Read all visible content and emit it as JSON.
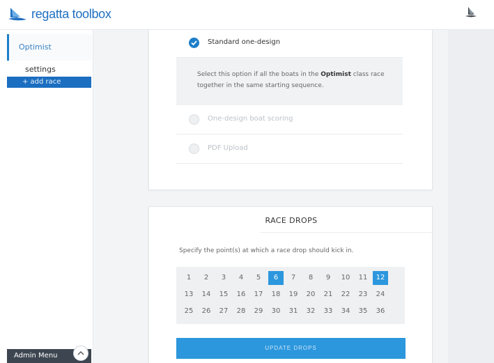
{
  "app": {
    "title": "regatta toolbox"
  },
  "sidebar": {
    "class_name": "Optimist",
    "settings_label": "settings",
    "add_race_label": "+ add race",
    "admin_menu_label": "Admin Menu"
  },
  "scoring": {
    "options": [
      {
        "label": "Standard one-design",
        "selected": true
      },
      {
        "label": "One-design boat scoring",
        "selected": false
      },
      {
        "label": "PDF Upload",
        "selected": false
      }
    ],
    "description_pre": "Select this option if all the boats in the ",
    "description_bold": "Optimist",
    "description_post": " class race together in the same starting sequence."
  },
  "race_drops": {
    "title": "RACE DROPS",
    "instruction": "Specify the point(s) at which a race drop should kick in.",
    "numbers": [
      1,
      2,
      3,
      4,
      5,
      6,
      7,
      8,
      9,
      10,
      11,
      12,
      13,
      14,
      15,
      16,
      17,
      18,
      19,
      20,
      21,
      22,
      23,
      24,
      25,
      26,
      27,
      28,
      29,
      30,
      31,
      32,
      33,
      34,
      35,
      36
    ],
    "selected": [
      6,
      12
    ],
    "update_button_label": "UPDATE DROPS"
  },
  "colors": {
    "brand_blue": "#1f6fc2",
    "accent": "#2c97dd",
    "admin_bg": "#3d4650"
  },
  "icons": {
    "brand": "sailboat-logo-icon",
    "selected_radio": "checkmark-icon",
    "admin_toggle": "chevron-up-icon"
  }
}
